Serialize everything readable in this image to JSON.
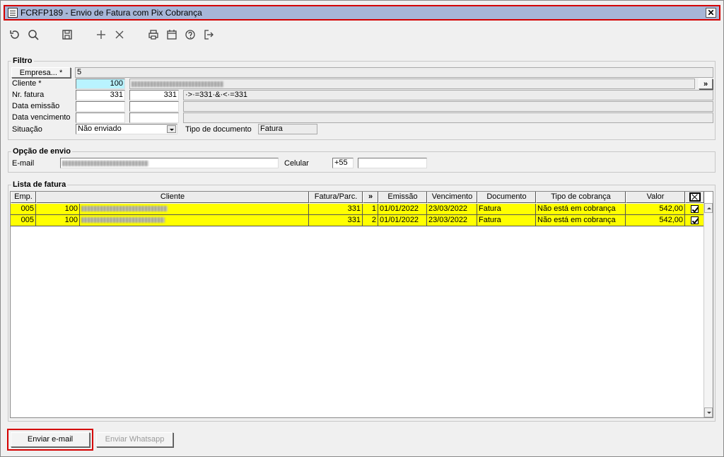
{
  "window": {
    "title": "FCRFP189 - Envio de Fatura com Pix Cobrança",
    "close_label": "✕"
  },
  "toolbar": {
    "icons": [
      "refresh-icon",
      "search-icon",
      "save-icon",
      "add-icon",
      "delete-icon",
      "print-icon",
      "calendar-icon",
      "help-icon",
      "exit-icon"
    ]
  },
  "filtro": {
    "title": "Filtro",
    "empresa_button": "Empresa... *",
    "empresa_value": "5",
    "cliente_label": "Cliente *",
    "cliente_code": "100",
    "cliente_search_button": "»",
    "nr_fatura_label": "Nr. fatura",
    "nr_fatura_from": "331",
    "nr_fatura_to": "331",
    "nr_fatura_expr": "·>·=331·&·<·=331",
    "data_emissao_label": "Data emissão",
    "data_vencimento_label": "Data vencimento",
    "situacao_label": "Situação",
    "situacao_value": "Não enviado",
    "tipo_documento_label": "Tipo de documento",
    "tipo_documento_value": "Fatura"
  },
  "opcao_envio": {
    "title": "Opção de envio",
    "email_label": "E-mail",
    "celular_label": "Celular",
    "celular_ddi": "+55",
    "celular_value": ""
  },
  "lista": {
    "title": "Lista de fatura",
    "columns": [
      "Emp.",
      "Cliente",
      "Fatura/Parc.",
      "»",
      "Emissão",
      "Vencimento",
      "Documento",
      "Tipo de cobrança",
      "Valor"
    ],
    "rows": [
      {
        "emp": "005",
        "cliente_code": "100",
        "fatura": "331",
        "parc": "1",
        "emissao": "01/01/2022",
        "vencimento": "23/03/2022",
        "documento": "Fatura",
        "tipo_cobranca": "Não está em cobrança",
        "valor": "542,00",
        "checked": true
      },
      {
        "emp": "005",
        "cliente_code": "100",
        "fatura": "331",
        "parc": "2",
        "emissao": "01/01/2022",
        "vencimento": "23/03/2022",
        "documento": "Fatura",
        "tipo_cobranca": "Não está em cobrança",
        "valor": "542,00",
        "checked": true
      }
    ]
  },
  "actions": {
    "send_email": "Enviar e-mail",
    "send_whatsapp": "Enviar Whatsapp"
  },
  "colors": {
    "titlebar": "#a7b6d7",
    "highlight_row": "#ffff00",
    "required_field": "#b9f3ff",
    "annotation_red": "#d40000"
  }
}
